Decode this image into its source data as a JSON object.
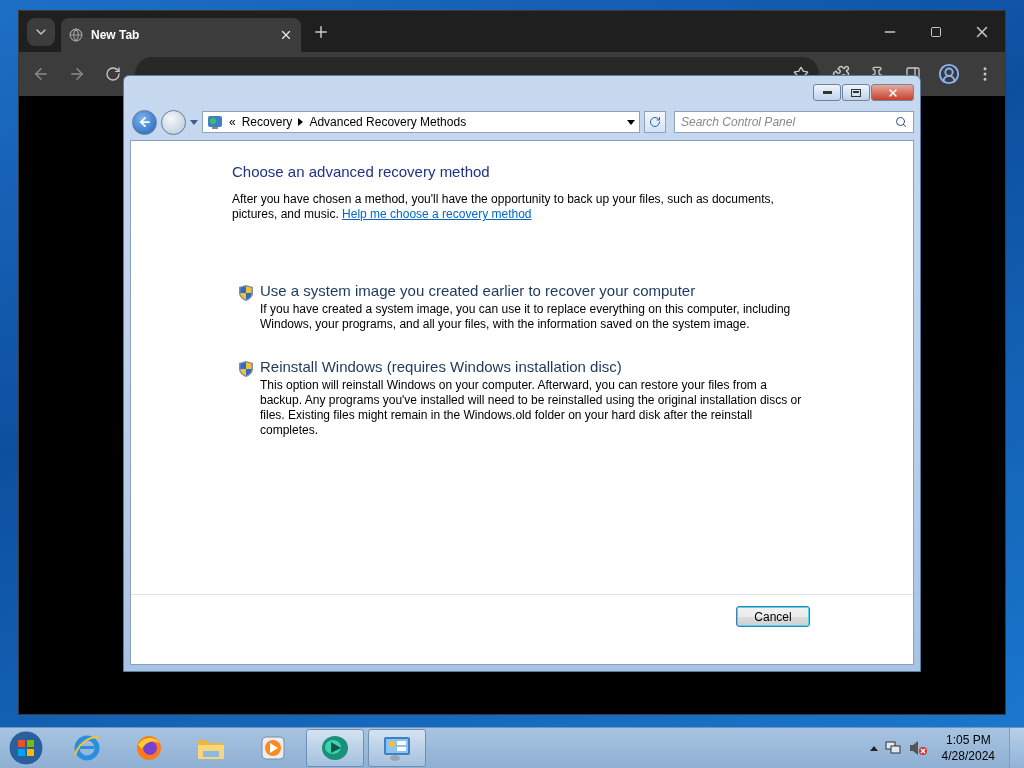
{
  "browser": {
    "tabs": [
      {
        "title": "New Tab",
        "selected": true
      }
    ]
  },
  "dialog": {
    "breadcrumb": {
      "overflow": "«",
      "items": [
        "Recovery",
        "Advanced Recovery Methods"
      ]
    },
    "search": {
      "placeholder": "Search Control Panel"
    },
    "heading": "Choose an advanced recovery method",
    "intro": "After you have chosen a method, you'll have the opportunity to back up your files, such as documents, pictures, and music.",
    "help_link": "Help me choose a recovery method",
    "options": [
      {
        "title": "Use a system image you created earlier to recover your computer",
        "description": "If you have created a system image, you can use it to replace everything on this computer, including Windows, your programs, and all your files, with the information saved on the system image."
      },
      {
        "title": "Reinstall Windows (requires Windows installation disc)",
        "description": "This option will reinstall Windows on your computer. Afterward, you can restore your files from a backup. Any programs you've installed will need to be reinstalled using the original installation discs or files. Existing files might remain in the Windows.old folder on your hard disk after the reinstall completes."
      }
    ],
    "buttons": [
      {
        "label": "Cancel",
        "default": true
      }
    ]
  },
  "taskbar": {
    "apps": [
      {
        "kind": "ie",
        "active": false
      },
      {
        "kind": "firefox",
        "active": false
      },
      {
        "kind": "explorer",
        "active": false
      },
      {
        "kind": "media",
        "active": false
      },
      {
        "kind": "vm",
        "active": true
      },
      {
        "kind": "control",
        "active": true
      }
    ],
    "clock": {
      "time": "1:05 PM",
      "date": "4/28/2024"
    }
  }
}
